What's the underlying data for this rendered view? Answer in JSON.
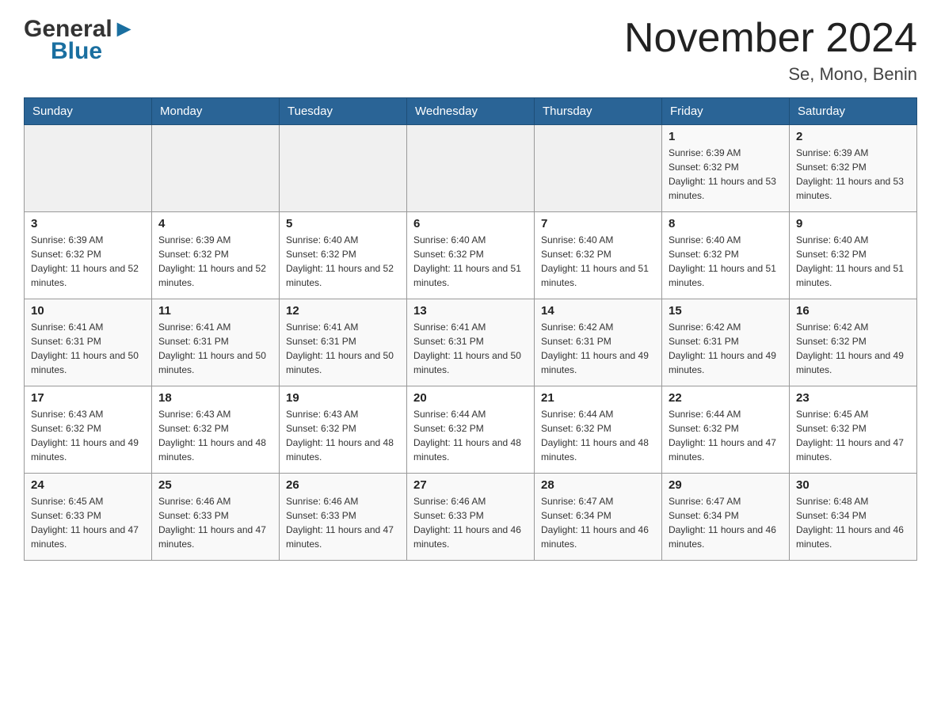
{
  "header": {
    "logo_general": "General",
    "logo_blue": "Blue",
    "calendar_title": "November 2024",
    "calendar_subtitle": "Se, Mono, Benin"
  },
  "weekdays": [
    "Sunday",
    "Monday",
    "Tuesday",
    "Wednesday",
    "Thursday",
    "Friday",
    "Saturday"
  ],
  "weeks": [
    [
      {
        "day": "",
        "sunrise": "",
        "sunset": "",
        "daylight": "",
        "empty": true
      },
      {
        "day": "",
        "sunrise": "",
        "sunset": "",
        "daylight": "",
        "empty": true
      },
      {
        "day": "",
        "sunrise": "",
        "sunset": "",
        "daylight": "",
        "empty": true
      },
      {
        "day": "",
        "sunrise": "",
        "sunset": "",
        "daylight": "",
        "empty": true
      },
      {
        "day": "",
        "sunrise": "",
        "sunset": "",
        "daylight": "",
        "empty": true
      },
      {
        "day": "1",
        "sunrise": "Sunrise: 6:39 AM",
        "sunset": "Sunset: 6:32 PM",
        "daylight": "Daylight: 11 hours and 53 minutes.",
        "empty": false
      },
      {
        "day": "2",
        "sunrise": "Sunrise: 6:39 AM",
        "sunset": "Sunset: 6:32 PM",
        "daylight": "Daylight: 11 hours and 53 minutes.",
        "empty": false
      }
    ],
    [
      {
        "day": "3",
        "sunrise": "Sunrise: 6:39 AM",
        "sunset": "Sunset: 6:32 PM",
        "daylight": "Daylight: 11 hours and 52 minutes.",
        "empty": false
      },
      {
        "day": "4",
        "sunrise": "Sunrise: 6:39 AM",
        "sunset": "Sunset: 6:32 PM",
        "daylight": "Daylight: 11 hours and 52 minutes.",
        "empty": false
      },
      {
        "day": "5",
        "sunrise": "Sunrise: 6:40 AM",
        "sunset": "Sunset: 6:32 PM",
        "daylight": "Daylight: 11 hours and 52 minutes.",
        "empty": false
      },
      {
        "day": "6",
        "sunrise": "Sunrise: 6:40 AM",
        "sunset": "Sunset: 6:32 PM",
        "daylight": "Daylight: 11 hours and 51 minutes.",
        "empty": false
      },
      {
        "day": "7",
        "sunrise": "Sunrise: 6:40 AM",
        "sunset": "Sunset: 6:32 PM",
        "daylight": "Daylight: 11 hours and 51 minutes.",
        "empty": false
      },
      {
        "day": "8",
        "sunrise": "Sunrise: 6:40 AM",
        "sunset": "Sunset: 6:32 PM",
        "daylight": "Daylight: 11 hours and 51 minutes.",
        "empty": false
      },
      {
        "day": "9",
        "sunrise": "Sunrise: 6:40 AM",
        "sunset": "Sunset: 6:32 PM",
        "daylight": "Daylight: 11 hours and 51 minutes.",
        "empty": false
      }
    ],
    [
      {
        "day": "10",
        "sunrise": "Sunrise: 6:41 AM",
        "sunset": "Sunset: 6:31 PM",
        "daylight": "Daylight: 11 hours and 50 minutes.",
        "empty": false
      },
      {
        "day": "11",
        "sunrise": "Sunrise: 6:41 AM",
        "sunset": "Sunset: 6:31 PM",
        "daylight": "Daylight: 11 hours and 50 minutes.",
        "empty": false
      },
      {
        "day": "12",
        "sunrise": "Sunrise: 6:41 AM",
        "sunset": "Sunset: 6:31 PM",
        "daylight": "Daylight: 11 hours and 50 minutes.",
        "empty": false
      },
      {
        "day": "13",
        "sunrise": "Sunrise: 6:41 AM",
        "sunset": "Sunset: 6:31 PM",
        "daylight": "Daylight: 11 hours and 50 minutes.",
        "empty": false
      },
      {
        "day": "14",
        "sunrise": "Sunrise: 6:42 AM",
        "sunset": "Sunset: 6:31 PM",
        "daylight": "Daylight: 11 hours and 49 minutes.",
        "empty": false
      },
      {
        "day": "15",
        "sunrise": "Sunrise: 6:42 AM",
        "sunset": "Sunset: 6:31 PM",
        "daylight": "Daylight: 11 hours and 49 minutes.",
        "empty": false
      },
      {
        "day": "16",
        "sunrise": "Sunrise: 6:42 AM",
        "sunset": "Sunset: 6:32 PM",
        "daylight": "Daylight: 11 hours and 49 minutes.",
        "empty": false
      }
    ],
    [
      {
        "day": "17",
        "sunrise": "Sunrise: 6:43 AM",
        "sunset": "Sunset: 6:32 PM",
        "daylight": "Daylight: 11 hours and 49 minutes.",
        "empty": false
      },
      {
        "day": "18",
        "sunrise": "Sunrise: 6:43 AM",
        "sunset": "Sunset: 6:32 PM",
        "daylight": "Daylight: 11 hours and 48 minutes.",
        "empty": false
      },
      {
        "day": "19",
        "sunrise": "Sunrise: 6:43 AM",
        "sunset": "Sunset: 6:32 PM",
        "daylight": "Daylight: 11 hours and 48 minutes.",
        "empty": false
      },
      {
        "day": "20",
        "sunrise": "Sunrise: 6:44 AM",
        "sunset": "Sunset: 6:32 PM",
        "daylight": "Daylight: 11 hours and 48 minutes.",
        "empty": false
      },
      {
        "day": "21",
        "sunrise": "Sunrise: 6:44 AM",
        "sunset": "Sunset: 6:32 PM",
        "daylight": "Daylight: 11 hours and 48 minutes.",
        "empty": false
      },
      {
        "day": "22",
        "sunrise": "Sunrise: 6:44 AM",
        "sunset": "Sunset: 6:32 PM",
        "daylight": "Daylight: 11 hours and 47 minutes.",
        "empty": false
      },
      {
        "day": "23",
        "sunrise": "Sunrise: 6:45 AM",
        "sunset": "Sunset: 6:32 PM",
        "daylight": "Daylight: 11 hours and 47 minutes.",
        "empty": false
      }
    ],
    [
      {
        "day": "24",
        "sunrise": "Sunrise: 6:45 AM",
        "sunset": "Sunset: 6:33 PM",
        "daylight": "Daylight: 11 hours and 47 minutes.",
        "empty": false
      },
      {
        "day": "25",
        "sunrise": "Sunrise: 6:46 AM",
        "sunset": "Sunset: 6:33 PM",
        "daylight": "Daylight: 11 hours and 47 minutes.",
        "empty": false
      },
      {
        "day": "26",
        "sunrise": "Sunrise: 6:46 AM",
        "sunset": "Sunset: 6:33 PM",
        "daylight": "Daylight: 11 hours and 47 minutes.",
        "empty": false
      },
      {
        "day": "27",
        "sunrise": "Sunrise: 6:46 AM",
        "sunset": "Sunset: 6:33 PM",
        "daylight": "Daylight: 11 hours and 46 minutes.",
        "empty": false
      },
      {
        "day": "28",
        "sunrise": "Sunrise: 6:47 AM",
        "sunset": "Sunset: 6:34 PM",
        "daylight": "Daylight: 11 hours and 46 minutes.",
        "empty": false
      },
      {
        "day": "29",
        "sunrise": "Sunrise: 6:47 AM",
        "sunset": "Sunset: 6:34 PM",
        "daylight": "Daylight: 11 hours and 46 minutes.",
        "empty": false
      },
      {
        "day": "30",
        "sunrise": "Sunrise: 6:48 AM",
        "sunset": "Sunset: 6:34 PM",
        "daylight": "Daylight: 11 hours and 46 minutes.",
        "empty": false
      }
    ]
  ]
}
